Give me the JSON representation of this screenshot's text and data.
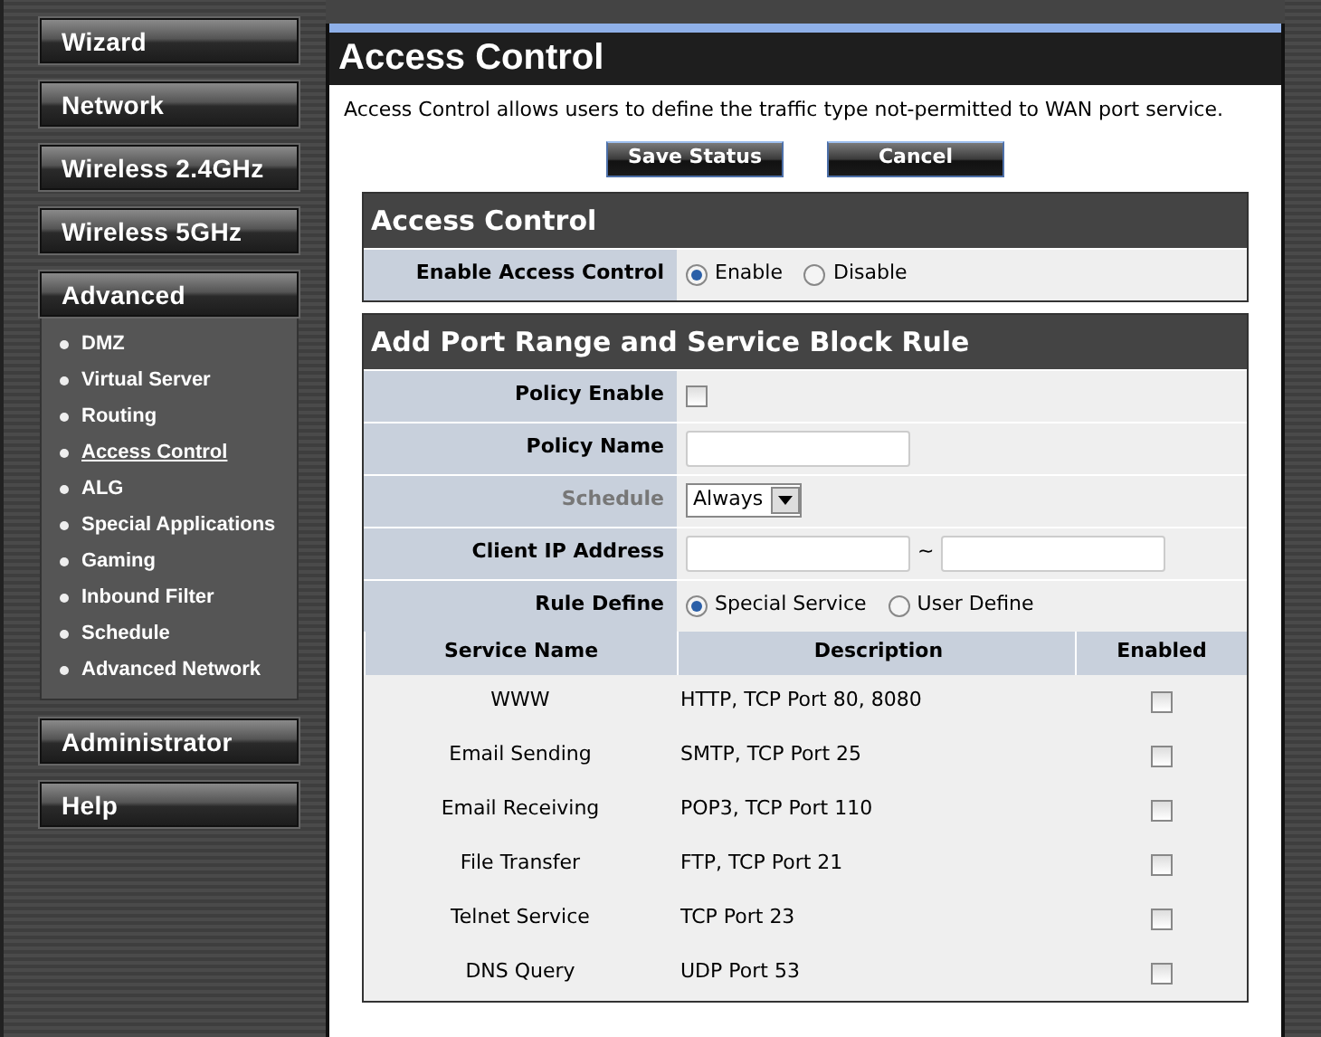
{
  "sidebar": {
    "items": [
      {
        "label": "Wizard"
      },
      {
        "label": "Network"
      },
      {
        "label": "Wireless 2.4GHz"
      },
      {
        "label": "Wireless 5GHz"
      },
      {
        "label": "Advanced",
        "children": [
          {
            "label": "DMZ",
            "selected": false
          },
          {
            "label": "Virtual Server",
            "selected": false
          },
          {
            "label": "Routing",
            "selected": false
          },
          {
            "label": "Access Control",
            "selected": true
          },
          {
            "label": "ALG",
            "selected": false
          },
          {
            "label": "Special Applications",
            "selected": false
          },
          {
            "label": "Gaming",
            "selected": false
          },
          {
            "label": "Inbound Filter",
            "selected": false
          },
          {
            "label": "Schedule",
            "selected": false
          },
          {
            "label": "Advanced Network",
            "selected": false
          }
        ]
      },
      {
        "label": "Administrator"
      },
      {
        "label": "Help"
      }
    ]
  },
  "page": {
    "title": "Access Control",
    "description": "Access Control allows users to define the traffic type not-permitted to WAN port service.",
    "buttons": [
      "Save Status",
      "Cancel"
    ]
  },
  "access_control": {
    "title": "Access Control",
    "label": "Enable Access Control",
    "options": [
      {
        "label": "Enable",
        "selected": true
      },
      {
        "label": "Disable",
        "selected": false
      }
    ]
  },
  "rule": {
    "title": "Add Port Range and Service Block Rule",
    "fields": [
      {
        "kind": "checkbox",
        "label": "Policy Enable",
        "disabled": false,
        "checked": false
      },
      {
        "kind": "text",
        "label": "Policy Name",
        "disabled": false
      },
      {
        "kind": "select",
        "label": "Schedule",
        "disabled": true,
        "value": "Always"
      },
      {
        "kind": "range",
        "label": "Client IP Address",
        "disabled": false,
        "separator": "~"
      },
      {
        "kind": "radio",
        "label": "Rule Define",
        "disabled": false,
        "options": [
          {
            "label": "Special Service",
            "selected": true
          },
          {
            "label": "User Define",
            "selected": false
          }
        ]
      }
    ],
    "table": {
      "columns": [
        "Service Name",
        "Description",
        "Enabled"
      ],
      "rows": [
        {
          "name": "WWW",
          "description": "HTTP, TCP Port 80, 8080",
          "checked": false
        },
        {
          "name": "Email Sending",
          "description": "SMTP, TCP Port 25",
          "checked": false
        },
        {
          "name": "Email Receiving",
          "description": "POP3, TCP Port 110",
          "checked": false
        },
        {
          "name": "File Transfer",
          "description": "FTP, TCP Port 21",
          "checked": false
        },
        {
          "name": "Telnet Service",
          "description": "TCP Port 23",
          "checked": false
        },
        {
          "name": "DNS Query",
          "description": "UDP Port 53",
          "checked": false
        }
      ]
    }
  }
}
